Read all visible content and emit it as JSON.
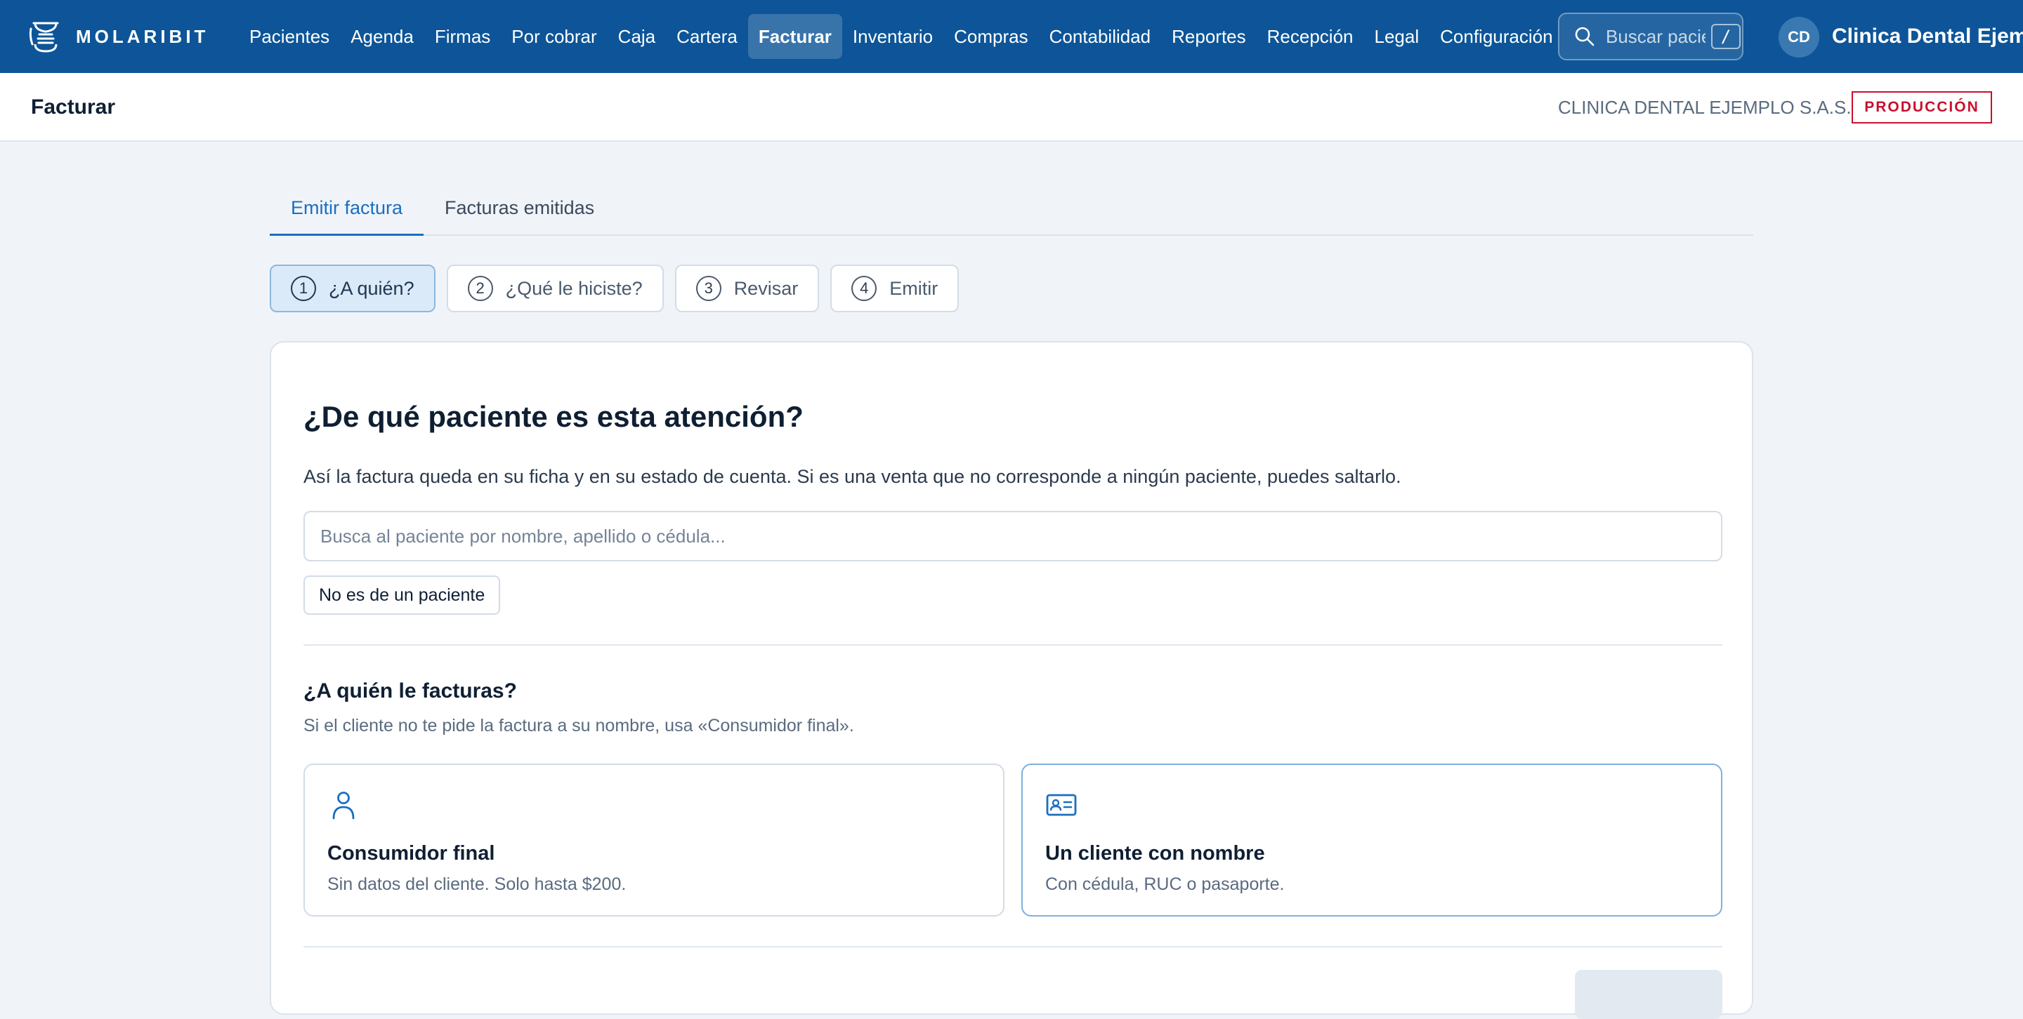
{
  "brand": {
    "name": "MOLARIBIT",
    "logo_icon": "dental-implant-logo-icon"
  },
  "nav": {
    "items": [
      {
        "label": "Pacientes"
      },
      {
        "label": "Agenda"
      },
      {
        "label": "Firmas"
      },
      {
        "label": "Por cobrar"
      },
      {
        "label": "Caja"
      },
      {
        "label": "Cartera"
      },
      {
        "label": "Facturar",
        "active": true
      },
      {
        "label": "Inventario"
      },
      {
        "label": "Compras"
      },
      {
        "label": "Contabilidad"
      },
      {
        "label": "Reportes"
      },
      {
        "label": "Recepción"
      },
      {
        "label": "Legal"
      },
      {
        "label": "Configuración"
      }
    ],
    "search": {
      "placeholder": "Buscar paciente",
      "shortcut": "/"
    },
    "user": {
      "initials": "CD",
      "clinic_name": "Clinica Dental Ejemplo"
    }
  },
  "header": {
    "title": "Facturar",
    "company": "CLINICA DENTAL EJEMPLO S.A.S.",
    "environment": "PRODUCCIÓN"
  },
  "tabs": [
    {
      "label": "Emitir factura",
      "active": true
    },
    {
      "label": "Facturas emitidas"
    }
  ],
  "steps": [
    {
      "num": "1",
      "label": "¿A quién?",
      "active": true
    },
    {
      "num": "2",
      "label": "¿Qué le hiciste?"
    },
    {
      "num": "3",
      "label": "Revisar"
    },
    {
      "num": "4",
      "label": "Emitir"
    }
  ],
  "patient_section": {
    "title": "¿De qué paciente es esta atención?",
    "description": "Así la factura queda en su ficha y en su estado de cuenta. Si es una venta que no corresponde a ningún paciente, puedes saltarlo.",
    "search_placeholder": "Busca al paciente por nombre, apellido o cédula...",
    "no_patient_button": "No es de un paciente"
  },
  "billing_section": {
    "title": "¿A quién le facturas?",
    "description": "Si el cliente no te pide la factura a su nombre, usa «Consumidor final».",
    "options": [
      {
        "title": "Consumidor final",
        "description": "Sin datos del cliente. Solo hasta $200.",
        "icon": "person-icon"
      },
      {
        "title": "Un cliente con nombre",
        "description": "Con cédula, RUC o pasaporte.",
        "icon": "id-card-icon",
        "selected": true
      }
    ]
  },
  "colors": {
    "primary_nav": "#0d5598",
    "accent": "#1a6fc0",
    "background": "#f0f4f9",
    "env_badge": "#c8102e"
  }
}
